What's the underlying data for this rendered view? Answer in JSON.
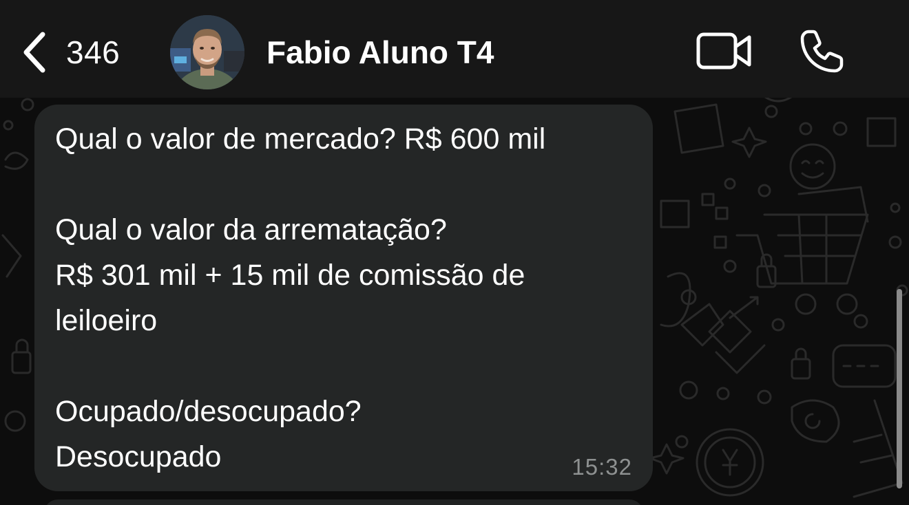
{
  "header": {
    "back_count": "346",
    "contact_name": "Fabio Aluno T4",
    "back_icon": "chevron-left-icon",
    "video_icon": "video-camera-icon",
    "call_icon": "phone-icon"
  },
  "message": {
    "lines": [
      "Qual o valor de mercado? R$ 600 mil",
      "Qual o valor da arrematação?",
      "R$ 301 mil + 15 mil de comissão de",
      "leiloeiro",
      "Ocupado/desocupado?",
      "Desocupado"
    ],
    "time": "15:32"
  },
  "colors": {
    "header_bg": "#171717",
    "chat_bg": "#0d0d0d",
    "bubble_bg": "#242626",
    "text": "#ffffff",
    "time_text": "#8e9191"
  }
}
